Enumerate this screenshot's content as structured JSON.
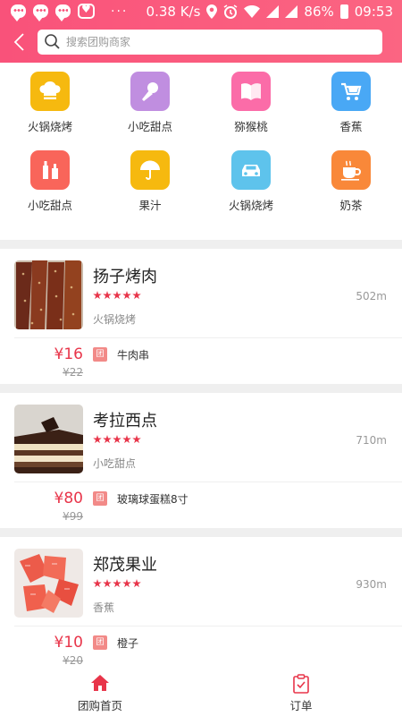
{
  "status_bar": {
    "speed": "0.38 K/s",
    "battery": "86%",
    "time": "09:53",
    "dots": "···"
  },
  "search": {
    "placeholder": "搜索团购商家"
  },
  "categories": [
    {
      "label": "火锅烧烤",
      "icon": "chef-hat-icon",
      "color": "#f6b90f"
    },
    {
      "label": "小吃甜点",
      "icon": "microphone-icon",
      "color": "#c08ee0"
    },
    {
      "label": "猕猴桃",
      "icon": "book-icon",
      "color": "#fb6ca8"
    },
    {
      "label": "香蕉",
      "icon": "shopping-cart-icon",
      "color": "#49a8f5"
    },
    {
      "label": "小吃甜点",
      "icon": "bottle-icon",
      "color": "#f9655a"
    },
    {
      "label": "果汁",
      "icon": "umbrella-icon",
      "color": "#f6b90f"
    },
    {
      "label": "火锅烧烤",
      "icon": "car-icon",
      "color": "#5ec3ec"
    },
    {
      "label": "奶茶",
      "icon": "coffee-cup-icon",
      "color": "#f98839"
    }
  ],
  "merchants": [
    {
      "name": "扬子烤肉",
      "category": "火锅烧烤",
      "distance": "502m",
      "rating": 5,
      "price": "¥16",
      "original_price": "¥22",
      "tag": "团",
      "deal": "牛肉串"
    },
    {
      "name": "考拉西点",
      "category": "小吃甜点",
      "distance": "710m",
      "rating": 5,
      "price": "¥80",
      "original_price": "¥99",
      "tag": "团",
      "deal": "玻璃球蛋糕8寸"
    },
    {
      "name": "郑茂果业",
      "category": "香蕉",
      "distance": "930m",
      "rating": 5,
      "price": "¥10",
      "original_price": "¥20",
      "tag": "团",
      "deal": "橙子"
    }
  ],
  "tabbar": {
    "home": {
      "label": "团购首页",
      "icon": "home-icon",
      "active_color": "#e8354a"
    },
    "orders": {
      "label": "订单",
      "icon": "clipboard-check-icon",
      "color": "#e8354a"
    }
  },
  "colors": {
    "header_start": "#f9527a",
    "header_end": "#fb6582",
    "accent": "#e8354a"
  }
}
